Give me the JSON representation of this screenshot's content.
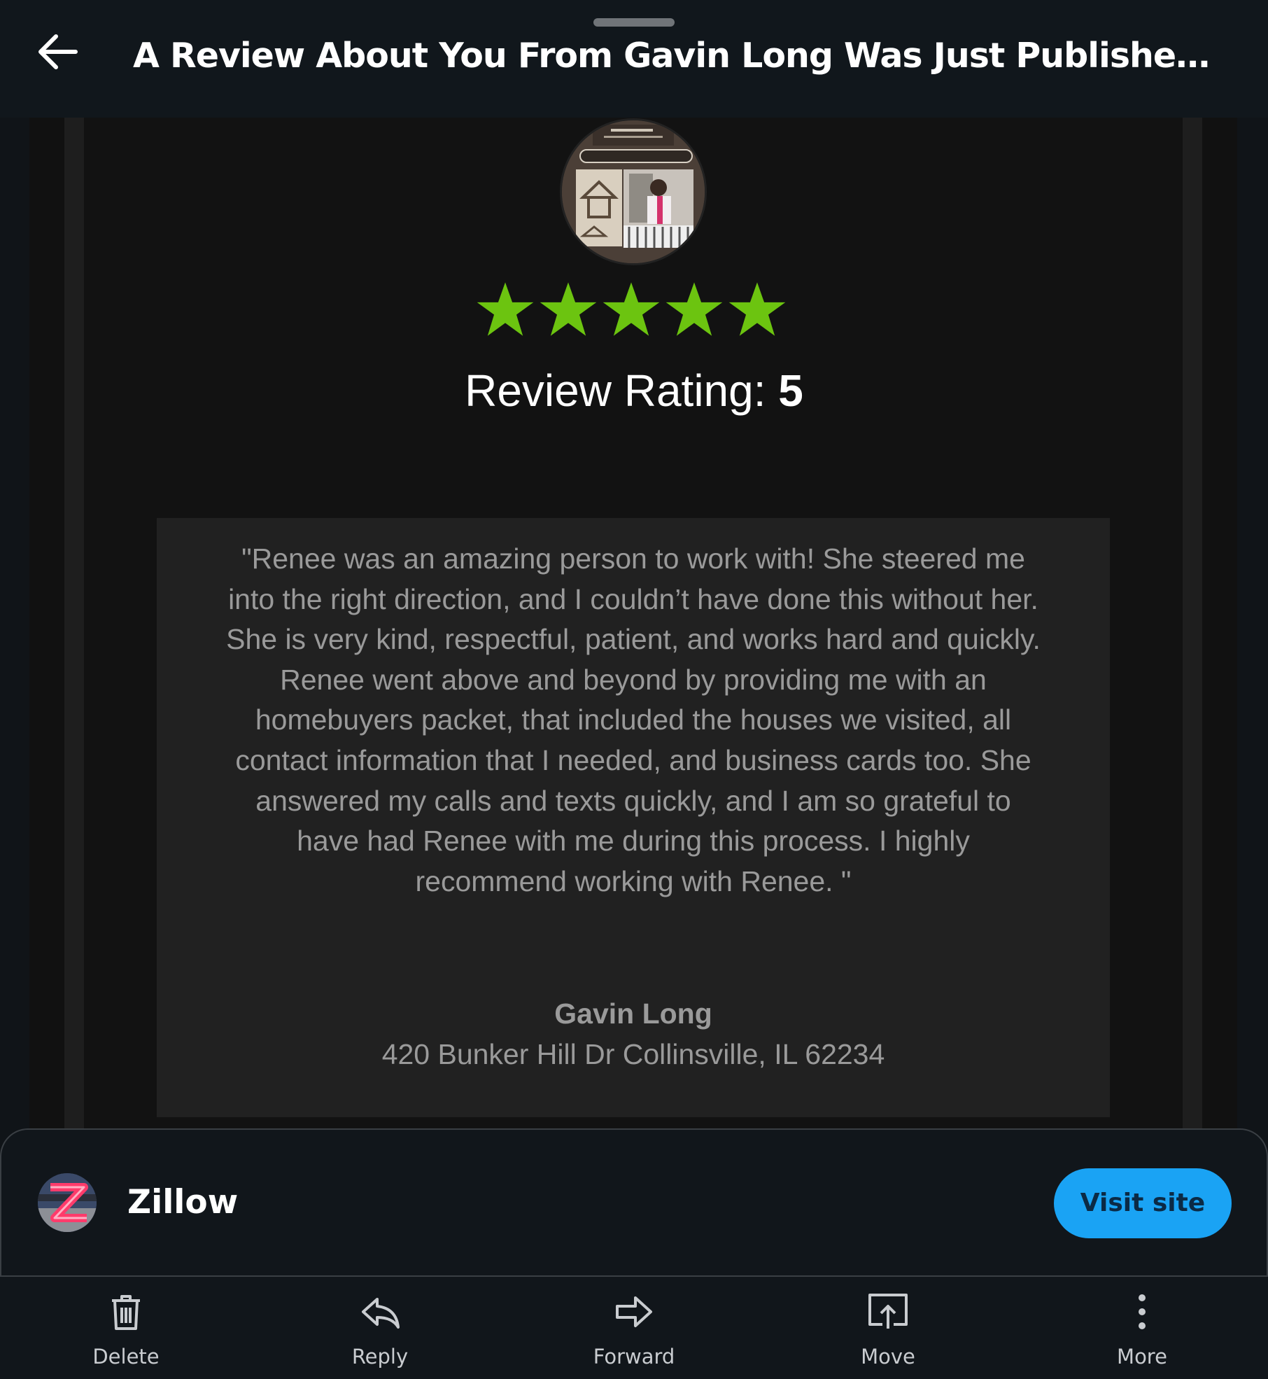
{
  "header": {
    "back_icon": "arrow-left-icon",
    "subject": "A Review About You From Gavin Long Was Just Published on Zill..."
  },
  "review": {
    "avatar_icon": "agent-photo-avatar",
    "stars": 5,
    "star_color": "#6cc410",
    "rating_label": "Review Rating: ",
    "rating_value": "5",
    "quote": "\"Renee was an amazing person to work with! She steered me into the right direction, and I couldn’t have done this without her. She is very kind, respectful, patient, and works hard and quickly. Renee went above and beyond by providing me with an homebuyers packet, that included the houses we visited, all contact information that I needed, and business cards too. She answered my calls and texts quickly, and I am so grateful to have had Renee with me during this process. I highly recommend working with Renee. \"",
    "reviewer_name": "Gavin Long",
    "reviewer_address": "420 Bunker Hill Dr Collinsville, IL 62234"
  },
  "sender": {
    "logo_icon": "zillow-logo-icon",
    "name": "Zillow",
    "visit_label": "Visit site",
    "visit_color": "#1aa3f4"
  },
  "toolbar": {
    "items": [
      {
        "label": "Delete",
        "icon": "trash-icon"
      },
      {
        "label": "Reply",
        "icon": "reply-icon"
      },
      {
        "label": "Forward",
        "icon": "forward-icon"
      },
      {
        "label": "Move",
        "icon": "move-icon"
      },
      {
        "label": "More",
        "icon": "more-vertical-icon"
      }
    ]
  }
}
